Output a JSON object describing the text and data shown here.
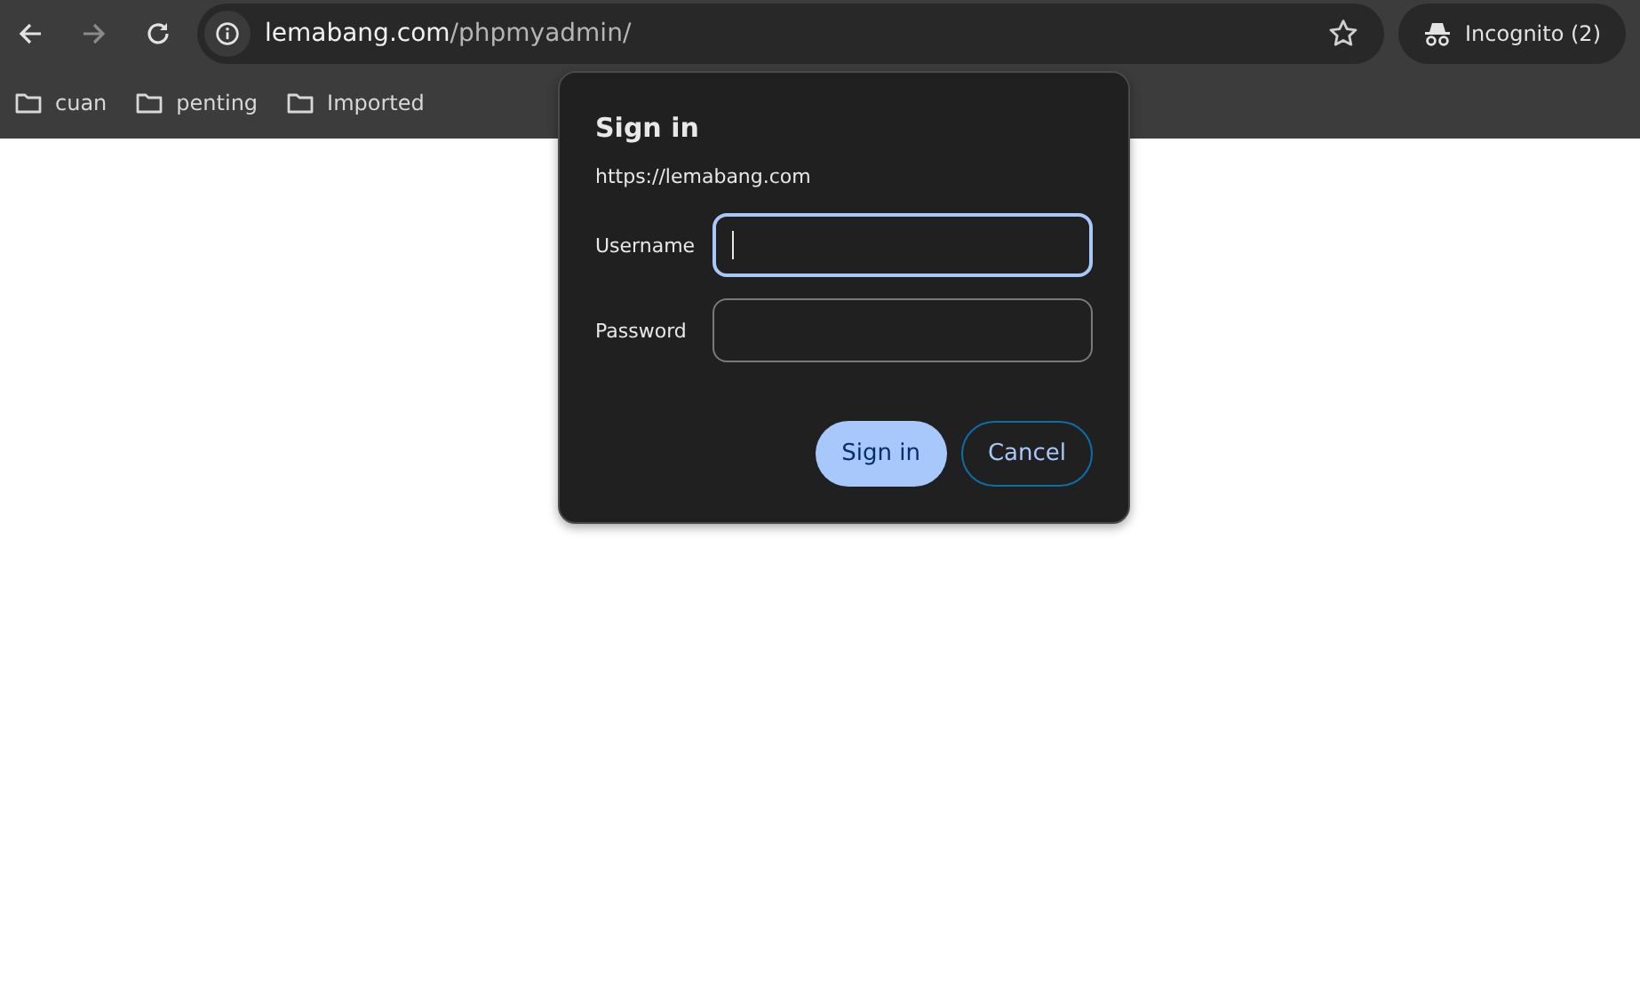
{
  "toolbar": {
    "back": {
      "disabled": false
    },
    "forward": {
      "disabled": true
    },
    "address": {
      "host": "lemabang.com",
      "path": "/phpmyadmin/"
    },
    "profile": {
      "label": "Incognito (2)"
    }
  },
  "bookmarks": [
    {
      "label": "cuan"
    },
    {
      "label": "penting"
    },
    {
      "label": "Imported"
    }
  ],
  "dialog": {
    "title": "Sign in",
    "origin": "https://lemabang.com",
    "fields": [
      {
        "label": "Username",
        "focused": true
      },
      {
        "label": "Password",
        "focused": false
      }
    ],
    "buttons": [
      {
        "label": "Sign in",
        "kind": "primary"
      },
      {
        "label": "Cancel",
        "kind": "secondary"
      }
    ]
  }
}
